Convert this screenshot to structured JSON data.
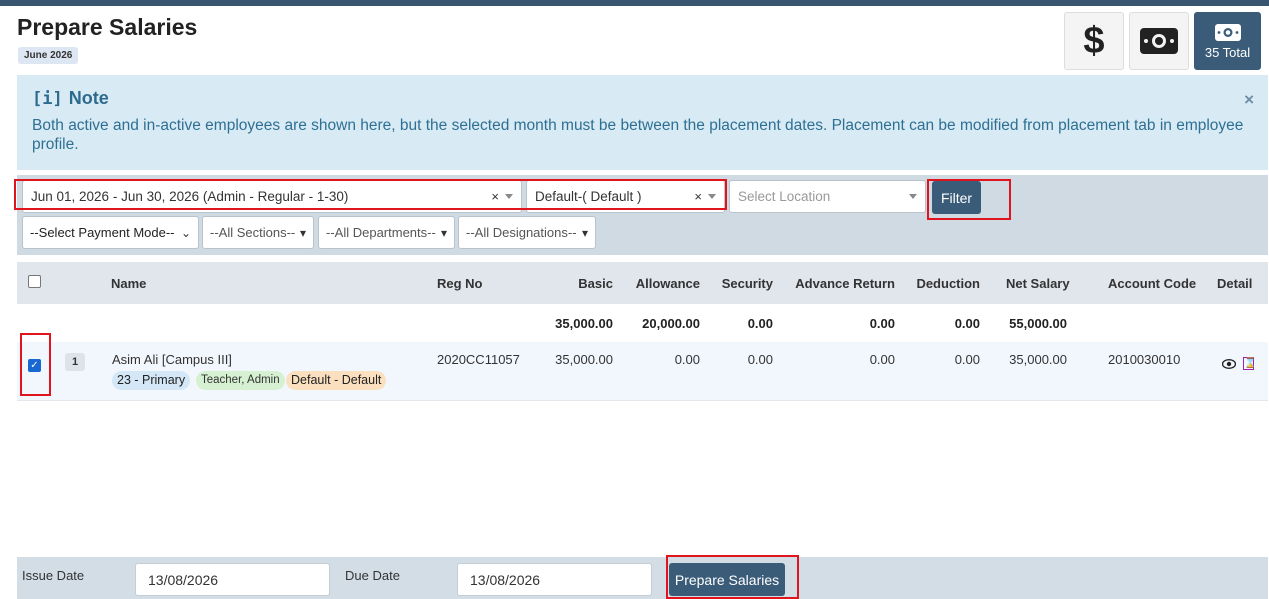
{
  "header": {
    "title": "Prepare Salaries",
    "month_badge": "June 2026",
    "buttons": {
      "dollar_icon": "$",
      "cash_icon": "cash-icon",
      "total_label": "35 Total"
    }
  },
  "note": {
    "title": "Note",
    "icon": "[i]",
    "text": "Both active and in-active employees are shown here, but the selected month must be between the placement dates. Placement can be modified from placement tab in employee profile.",
    "close": "×"
  },
  "filters": {
    "period": "Jun 01, 2026 - Jun 30, 2026 (Admin - Regular - 1-30)",
    "default_sel": "Default-( Default )",
    "location_placeholder": "Select Location",
    "filter_button": "Filter",
    "payment_mode": "--Select Payment Mode--",
    "sections": "--All Sections--",
    "departments": "--All Departments--",
    "designations": "--All Designations--",
    "clear_symbol": "×"
  },
  "table": {
    "columns": [
      "Name",
      "Reg No",
      "Basic",
      "Allowance",
      "Security",
      "Advance Return",
      "Deduction",
      "Net Salary",
      "Account Code",
      "Detail"
    ],
    "totals": {
      "basic": "35,000.00",
      "allowance": "20,000.00",
      "security": "0.00",
      "advance_return": "0.00",
      "deduction": "0.00",
      "net_salary": "55,000.00"
    },
    "rows": [
      {
        "index": "1",
        "name": "Asim Ali [Campus III]",
        "class_tag": "23 - Primary",
        "role_tag": "Teacher,  Admin",
        "default_tag": "Default - Default",
        "reg_no": "2020CC11057",
        "basic": "35,000.00",
        "allowance": "0.00",
        "security": "0.00",
        "advance_return": "0.00",
        "deduction": "0.00",
        "net_salary": "35,000.00",
        "account_code": "2010030010"
      }
    ]
  },
  "footer": {
    "issue_date_label": "Issue Date",
    "issue_date": "13/08/2026",
    "due_date_label": "Due Date",
    "due_date": "13/08/2026",
    "prepare_button": "Prepare Salaries"
  },
  "colors": {
    "primary": "#3b5c78",
    "note_bg": "#d8ebf4",
    "highlight": "#e0141c"
  }
}
